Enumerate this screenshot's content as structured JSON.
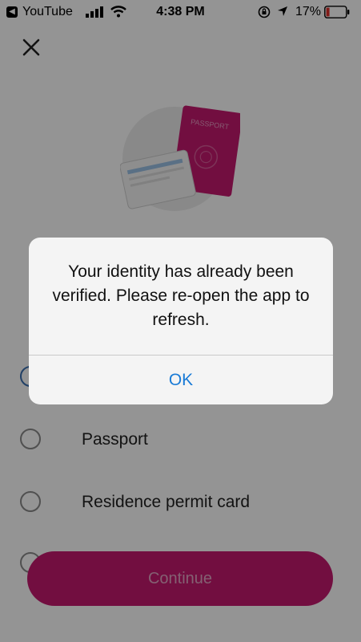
{
  "status_bar": {
    "back_app": "YouTube",
    "time": "4:38 PM",
    "battery_percent": "17%",
    "battery_level": 0.17
  },
  "icons": {
    "close": "close-icon",
    "hero": "id-documents-illustration",
    "hero_passport_text": "PASSPORT"
  },
  "options": [
    {
      "label": "",
      "selected": true
    },
    {
      "label": "Passport",
      "selected": false
    },
    {
      "label": "Residence permit card",
      "selected": false
    },
    {
      "label": "",
      "selected": false
    }
  ],
  "continue_label": "Continue",
  "alert": {
    "message": "Your identity has already been verified. Please re-open the app to refresh.",
    "ok_label": "OK"
  },
  "colors": {
    "brand": "#c4196f",
    "alert_action": "#1a7bd6",
    "battery_low": "#e0302a"
  }
}
